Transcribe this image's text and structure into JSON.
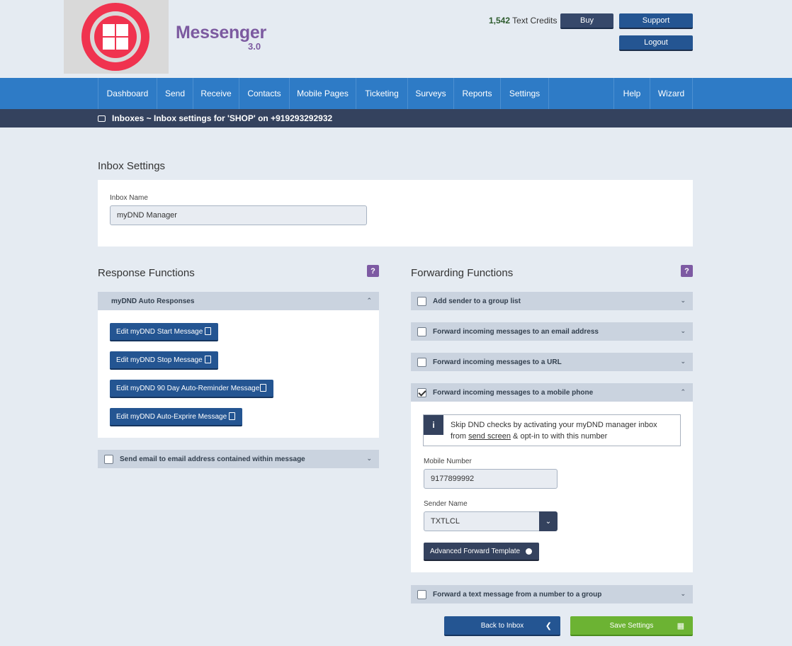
{
  "header": {
    "brand": "Messenger",
    "version": "3.0",
    "credits_count": "1,542",
    "credits_label": "Text Credits",
    "buy_label": "Buy",
    "support_label": "Support",
    "logout_label": "Logout"
  },
  "nav": {
    "items": [
      "Dashboard",
      "Send",
      "Receive",
      "Contacts",
      "Mobile Pages",
      "Ticketing",
      "Surveys",
      "Reports",
      "Settings"
    ],
    "right_items": [
      "Help",
      "Wizard"
    ]
  },
  "breadcrumb": "Inboxes ~ Inbox settings for 'SHOP' on +919293292932",
  "inbox_settings": {
    "title": "Inbox Settings",
    "name_label": "Inbox Name",
    "name_value": "myDND Manager"
  },
  "response": {
    "title": "Response Functions",
    "help": "?",
    "accordion_title": "myDND Auto Responses",
    "buttons": [
      "Edit myDND Start Message",
      "Edit myDND Stop Message",
      "Edit myDND 90 Day Auto-Reminder Message",
      "Edit myDND Auto-Exprire Message"
    ],
    "email_option": "Send email to email address contained within message"
  },
  "forwarding": {
    "title": "Forwarding Functions",
    "help": "?",
    "options": [
      "Add sender to a group list",
      "Forward incoming messages to an email address",
      "Forward incoming messages to a URL",
      "Forward incoming messages to a mobile phone",
      "Forward a text message from a number to a group"
    ],
    "checked": [
      false,
      false,
      false,
      true,
      false
    ],
    "info_icon": "i",
    "info_line1": "Skip DND checks by activating your myDND manager inbox",
    "info_pre": "from ",
    "info_link": "send screen",
    "info_post": " & opt-in to with this number",
    "mobile_label": "Mobile Number",
    "mobile_value": "9177899992",
    "sender_label": "Sender Name",
    "sender_value": "TXTLCL",
    "template_button": "Advanced Forward Template"
  },
  "footer": {
    "back_label": "Back to Inbox",
    "save_label": "Save Settings"
  },
  "colors": {
    "nav": "#2e7bc6",
    "subbar": "#34425e",
    "primary_button": "#245592",
    "save_button": "#6cb333",
    "brand": "#7c5aa0",
    "logo": "#f0334f"
  }
}
